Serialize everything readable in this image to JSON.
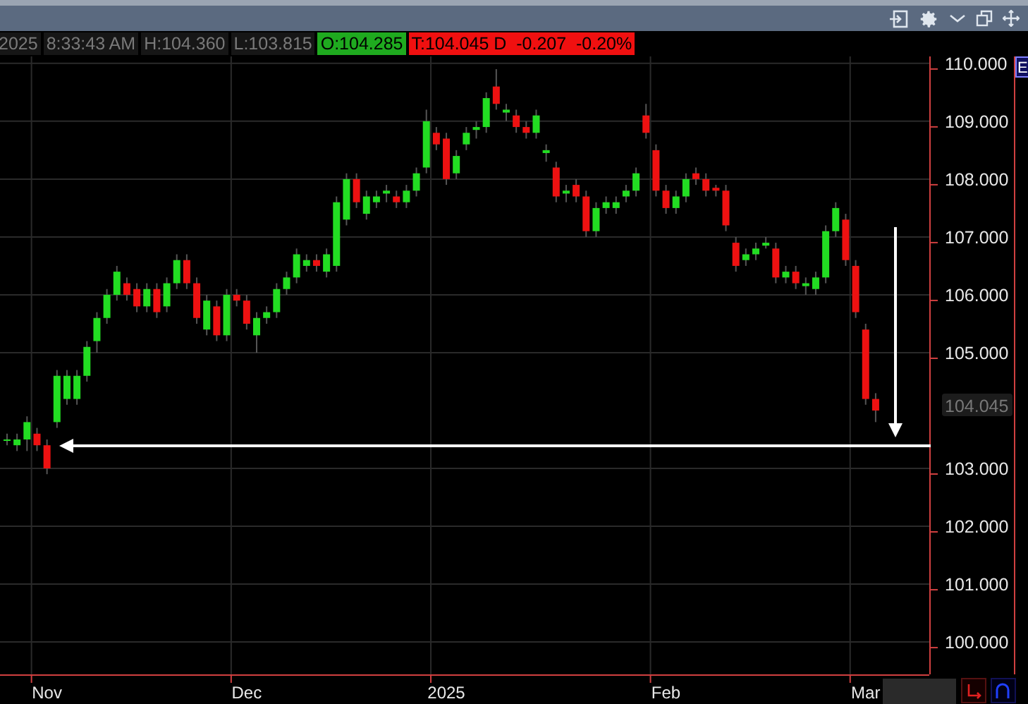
{
  "quote": {
    "fields": [
      {
        "text": "2025",
        "kind": "muted"
      },
      {
        "text": "8:33:43 AM",
        "kind": "muted"
      },
      {
        "text": "H:104.360",
        "kind": "muted"
      },
      {
        "text": "L:103.815",
        "kind": "muted"
      },
      {
        "text": "O:104.285",
        "kind": "up"
      },
      {
        "text": "T:104.045 D  -0.207  -0.20%",
        "kind": "down"
      }
    ]
  },
  "chart": {
    "last_price": "104.045",
    "chart_data": {
      "type": "candlestick",
      "categories": [
        null,
        null,
        null,
        null,
        "Nov",
        null,
        null,
        null,
        null,
        null,
        null,
        null,
        null,
        null,
        null,
        null,
        null,
        null,
        null,
        null,
        null,
        null,
        null,
        null,
        "Dec",
        null,
        null,
        null,
        null,
        null,
        null,
        null,
        null,
        null,
        null,
        null,
        null,
        null,
        null,
        null,
        null,
        null,
        null,
        null,
        "2025",
        null,
        null,
        null,
        null,
        null,
        null,
        null,
        null,
        null,
        null,
        null,
        null,
        null,
        null,
        null,
        null,
        null,
        null,
        null,
        null,
        null,
        "Feb",
        null,
        null,
        null,
        null,
        null,
        null,
        null,
        null,
        null,
        null,
        null,
        null,
        null,
        null,
        null,
        null,
        null,
        null,
        null,
        "Mar",
        null
      ],
      "ylim": [
        99.44,
        110.12
      ],
      "grid": true,
      "ohlc": [
        [
          103.5,
          103.6,
          103.4,
          103.5
        ],
        [
          103.4,
          103.6,
          103.3,
          103.5
        ],
        [
          103.5,
          103.9,
          103.3,
          103.8
        ],
        [
          103.6,
          103.7,
          103.3,
          103.4
        ],
        [
          103.4,
          103.5,
          102.9,
          103.0
        ],
        [
          103.8,
          104.7,
          103.7,
          104.6
        ],
        [
          104.2,
          104.7,
          104.1,
          104.6
        ],
        [
          104.2,
          104.7,
          104.1,
          104.6
        ],
        [
          104.6,
          105.2,
          104.5,
          105.1
        ],
        [
          105.2,
          105.7,
          105.0,
          105.6
        ],
        [
          105.6,
          106.1,
          105.5,
          106.0
        ],
        [
          106.0,
          106.5,
          105.9,
          106.4
        ],
        [
          106.2,
          106.3,
          105.9,
          106.0
        ],
        [
          106.1,
          106.2,
          105.7,
          105.8
        ],
        [
          105.8,
          106.2,
          105.7,
          106.1
        ],
        [
          106.1,
          106.2,
          105.6,
          105.7
        ],
        [
          105.8,
          106.3,
          105.7,
          106.2
        ],
        [
          106.2,
          106.7,
          106.1,
          106.6
        ],
        [
          106.6,
          106.7,
          106.1,
          106.2
        ],
        [
          106.2,
          106.3,
          105.5,
          105.6
        ],
        [
          105.4,
          106.0,
          105.3,
          105.9
        ],
        [
          105.8,
          105.9,
          105.2,
          105.3
        ],
        [
          105.3,
          106.1,
          105.2,
          106.0
        ],
        [
          106.0,
          106.1,
          105.8,
          105.9
        ],
        [
          105.9,
          106.0,
          105.4,
          105.5
        ],
        [
          105.3,
          105.7,
          105.0,
          105.6
        ],
        [
          105.6,
          105.8,
          105.5,
          105.7
        ],
        [
          105.7,
          106.2,
          105.6,
          106.1
        ],
        [
          106.1,
          106.4,
          106.0,
          106.3
        ],
        [
          106.3,
          106.8,
          106.2,
          106.7
        ],
        [
          106.5,
          106.7,
          106.4,
          106.6
        ],
        [
          106.6,
          106.7,
          106.4,
          106.5
        ],
        [
          106.4,
          106.8,
          106.3,
          106.7
        ],
        [
          106.5,
          107.7,
          106.4,
          107.6
        ],
        [
          107.3,
          108.1,
          107.2,
          108.0
        ],
        [
          108.0,
          108.1,
          107.5,
          107.6
        ],
        [
          107.4,
          107.8,
          107.3,
          107.7
        ],
        [
          107.6,
          107.8,
          107.5,
          107.7
        ],
        [
          107.75,
          107.9,
          107.6,
          107.8
        ],
        [
          107.7,
          107.8,
          107.5,
          107.6
        ],
        [
          107.6,
          107.9,
          107.5,
          107.8
        ],
        [
          107.8,
          108.2,
          107.7,
          108.1
        ],
        [
          108.2,
          109.2,
          108.1,
          109.0
        ],
        [
          108.8,
          108.9,
          108.5,
          108.6
        ],
        [
          108.7,
          108.8,
          107.9,
          108.0
        ],
        [
          108.1,
          108.5,
          108.0,
          108.4
        ],
        [
          108.6,
          108.9,
          108.5,
          108.8
        ],
        [
          108.85,
          109.0,
          108.7,
          108.9
        ],
        [
          108.9,
          109.5,
          108.8,
          109.4
        ],
        [
          109.6,
          109.9,
          109.2,
          109.3
        ],
        [
          109.15,
          109.3,
          109.0,
          109.2
        ],
        [
          109.1,
          109.2,
          108.8,
          108.9
        ],
        [
          108.9,
          109.0,
          108.7,
          108.8
        ],
        [
          108.8,
          109.2,
          108.7,
          109.1
        ],
        [
          108.45,
          108.6,
          108.3,
          108.5
        ],
        [
          108.2,
          108.3,
          107.6,
          107.7
        ],
        [
          107.75,
          107.9,
          107.6,
          107.8
        ],
        [
          107.9,
          108.0,
          107.6,
          107.7
        ],
        [
          107.7,
          107.8,
          107.0,
          107.1
        ],
        [
          107.1,
          107.6,
          107.0,
          107.5
        ],
        [
          107.5,
          107.7,
          107.4,
          107.6
        ],
        [
          107.5,
          107.7,
          107.4,
          107.6
        ],
        [
          107.7,
          107.9,
          107.6,
          107.8
        ],
        [
          107.8,
          108.2,
          107.7,
          108.1
        ],
        [
          109.1,
          109.3,
          108.7,
          108.8
        ],
        [
          108.5,
          108.6,
          107.7,
          107.8
        ],
        [
          107.8,
          107.9,
          107.4,
          107.5
        ],
        [
          107.5,
          107.8,
          107.4,
          107.7
        ],
        [
          107.7,
          108.1,
          107.6,
          108.0
        ],
        [
          108.1,
          108.2,
          107.9,
          108.0
        ],
        [
          108.0,
          108.1,
          107.7,
          107.8
        ],
        [
          107.85,
          107.9,
          107.7,
          107.8
        ],
        [
          107.8,
          107.9,
          107.1,
          107.2
        ],
        [
          106.9,
          107.0,
          106.4,
          106.5
        ],
        [
          106.6,
          106.8,
          106.5,
          106.7
        ],
        [
          106.7,
          106.9,
          106.6,
          106.8
        ],
        [
          106.85,
          107.0,
          106.8,
          106.9
        ],
        [
          106.8,
          106.9,
          106.2,
          106.3
        ],
        [
          106.3,
          106.5,
          106.2,
          106.4
        ],
        [
          106.4,
          106.5,
          106.1,
          106.2
        ],
        [
          106.15,
          106.3,
          106.0,
          106.2
        ],
        [
          106.1,
          106.4,
          106.0,
          106.3
        ],
        [
          106.3,
          107.2,
          106.2,
          107.1
        ],
        [
          107.1,
          107.6,
          107.0,
          107.5
        ],
        [
          107.3,
          107.4,
          106.5,
          106.6
        ],
        [
          106.5,
          106.6,
          105.6,
          105.7
        ],
        [
          105.4,
          105.5,
          104.1,
          104.2
        ],
        [
          104.2,
          104.3,
          103.8,
          104.0
        ]
      ],
      "yticks": [
        {
          "value": 110,
          "label": "110.000"
        },
        {
          "value": 109,
          "label": "109.000"
        },
        {
          "value": 108,
          "label": "108.000"
        },
        {
          "value": 107,
          "label": "107.000"
        },
        {
          "value": 106,
          "label": "106.000"
        },
        {
          "value": 105,
          "label": "105.000"
        },
        {
          "value": 103,
          "label": "103.000"
        },
        {
          "value": 102,
          "label": "102.000"
        },
        {
          "value": 101,
          "label": "101.000"
        },
        {
          "value": 100,
          "label": "100.000"
        }
      ]
    },
    "side_tag": "E"
  }
}
